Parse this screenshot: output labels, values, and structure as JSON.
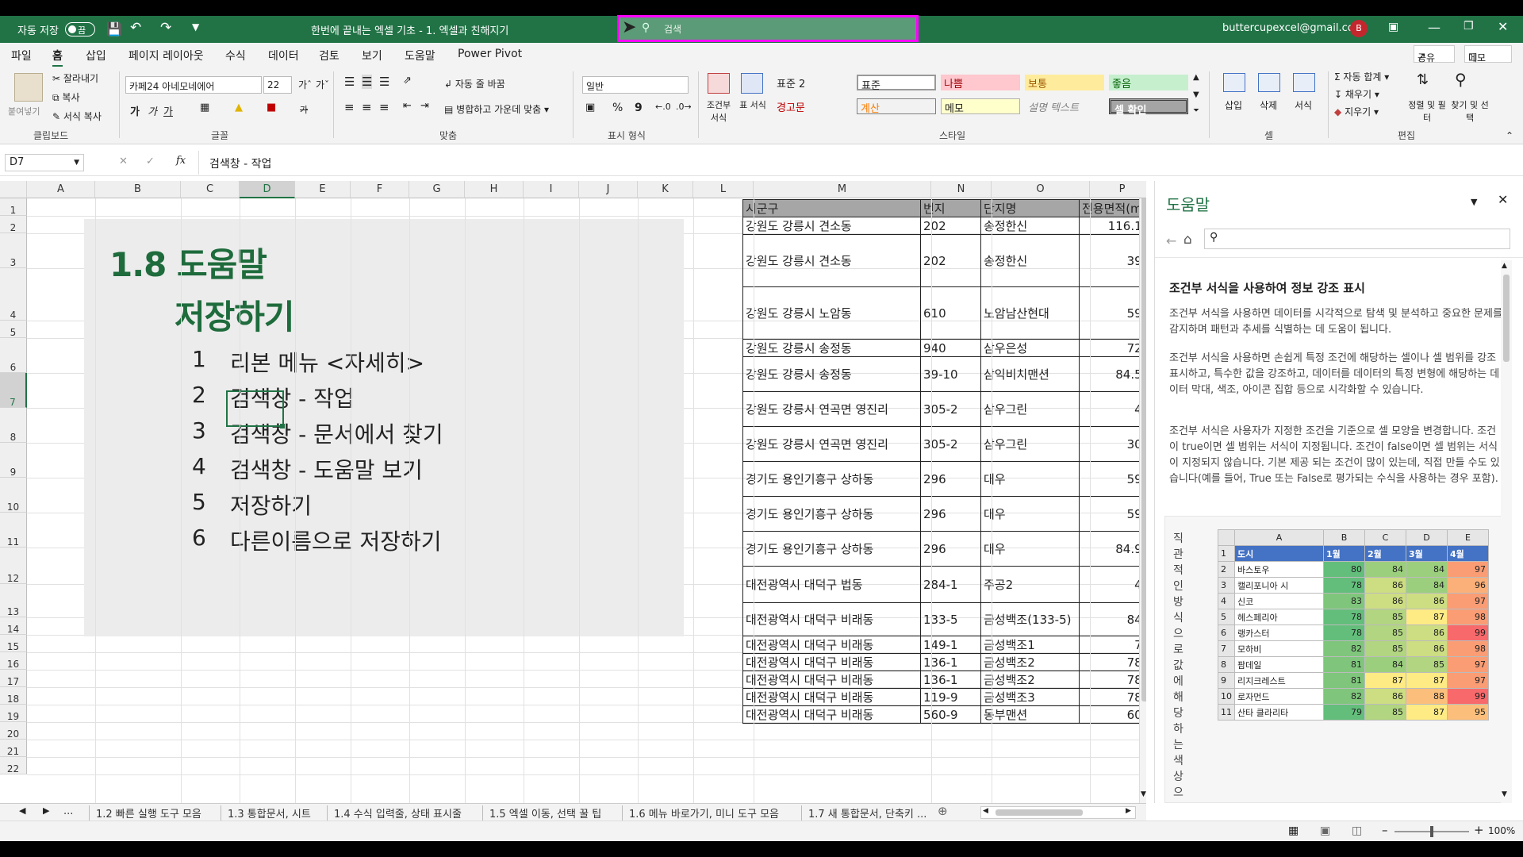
{
  "titlebar": {
    "autosave_label": "자동 저장",
    "toggle_state": "끔",
    "doc_title": "한번에 끝내는 엑셀 기초 - 1. 엑셀과 친해지기",
    "search_placeholder": "검색",
    "user_email": "buttercupexcel@gmail.com",
    "avatar_initial": "B"
  },
  "ribbon_tabs": [
    "파일",
    "홈",
    "삽입",
    "페이지 레이아웃",
    "수식",
    "데이터",
    "검토",
    "보기",
    "도움말",
    "Power Pivot"
  ],
  "share_label": "공유",
  "memo_label": "메모",
  "clipboard": {
    "paste": "붙여넣기",
    "cut": "잘라내기",
    "copy": "복사",
    "format_painter": "서식 복사",
    "group": "클립보드"
  },
  "font": {
    "name": "카페24 아네모네에어",
    "size": "22",
    "group": "글꼴",
    "bold": "가",
    "italic": "가",
    "underline": "가",
    "strike": "가"
  },
  "align": {
    "wrap": "자동 줄 바꿈",
    "merge": "병합하고 가운데 맞춤",
    "group": "맞춤"
  },
  "number": {
    "format": "일반",
    "group": "표시 형식",
    "percent": "%",
    "comma": "9"
  },
  "styles": {
    "conditional": "조건부 서식",
    "table": "표 서식",
    "group": "스타일",
    "cells": [
      "표준 2",
      "표준",
      "나쁨",
      "보통",
      "좋음",
      "경고문",
      "계산",
      "메모",
      "설명 텍스트",
      "셀 확인"
    ]
  },
  "cells_group": {
    "insert": "삽입",
    "delete": "삭제",
    "format": "서식",
    "group": "셀"
  },
  "edit_group": {
    "autosum": "자동 합계",
    "fill": "채우기",
    "clear": "지우기",
    "sort": "정렬 및 필터",
    "find": "찾기 및 선택",
    "group": "편집"
  },
  "formula_bar": {
    "name_box": "D7",
    "fx": "fx",
    "content": "검색창 - 작업"
  },
  "columns": [
    "A",
    "B",
    "C",
    "D",
    "E",
    "F",
    "G",
    "H",
    "I",
    "J",
    "K",
    "L",
    "M",
    "N",
    "O",
    "P"
  ],
  "rows": [
    "1",
    "2",
    "3",
    "4",
    "5",
    "6",
    "7",
    "8",
    "9",
    "10",
    "11",
    "12",
    "13",
    "14",
    "15",
    "16",
    "17",
    "18",
    "19",
    "20",
    "21",
    "22"
  ],
  "slide": {
    "title_line1": "1.8 도움말",
    "title_line2": "저장하기",
    "items": [
      {
        "num": "1",
        "text": "리본 메뉴 <자세히>"
      },
      {
        "num": "2",
        "text": "검색창 - 작업"
      },
      {
        "num": "3",
        "text": "검색창 - 문서에서 찾기"
      },
      {
        "num": "4",
        "text": "검색창 - 도움말 보기"
      },
      {
        "num": "5",
        "text": "저장하기"
      },
      {
        "num": "6",
        "text": "다른이름으로 저장하기"
      }
    ]
  },
  "table": {
    "headers": [
      "시군구",
      "번지",
      "단지명",
      "전용면적(m"
    ],
    "rows": [
      [
        "강원도 강릉시 견소동",
        "202",
        "송정한신",
        "116.1"
      ],
      [
        "강원도 강릉시 견소동",
        "202",
        "송정한신",
        "39"
      ],
      [
        "강원도 강릉시 노암동",
        "610",
        "노암남산현대",
        "59"
      ],
      [
        "강원도 강릉시 송정동",
        "940",
        "삼우은성",
        "72"
      ],
      [
        "강원도 강릉시 송정동",
        "39-10",
        "삼익비치맨션",
        "84.5"
      ],
      [
        "강원도 강릉시 연곡면 영진리",
        "305-2",
        "삼우그린",
        "4"
      ],
      [
        "강원도 강릉시 연곡면 영진리",
        "305-2",
        "삼우그린",
        "30"
      ],
      [
        "경기도 용인기흥구 상하동",
        "296",
        "대우",
        "59"
      ],
      [
        "경기도 용인기흥구 상하동",
        "296",
        "대우",
        "59"
      ],
      [
        "경기도 용인기흥구 상하동",
        "296",
        "대우",
        "84.9"
      ],
      [
        "대전광역시 대덕구 법동",
        "284-1",
        "주공2",
        "4"
      ],
      [
        "대전광역시 대덕구 비래동",
        "133-5",
        "금성백조(133-5)",
        "84"
      ],
      [
        "대전광역시 대덕구 비래동",
        "149-1",
        "금성백조1",
        "7"
      ],
      [
        "대전광역시 대덕구 비래동",
        "136-1",
        "금성백조2",
        "78"
      ],
      [
        "대전광역시 대덕구 비래동",
        "136-1",
        "금성백조2",
        "78"
      ],
      [
        "대전광역시 대덕구 비래동",
        "119-9",
        "금성백조3",
        "78"
      ],
      [
        "대전광역시 대덕구 비래동",
        "560-9",
        "동부맨션",
        "60"
      ]
    ]
  },
  "help": {
    "title": "도움말",
    "heading": "조건부 서식을 사용하여 정보 강조 표시",
    "p1": "조건부 서식을 사용하면 데이터를 시각적으로 탐색 및 분석하고 중요한 문제를 감지하며 패턴과 추세를 식별하는 데 도움이 됩니다.",
    "p2": "조건부 서식을 사용하면 손쉽게 특정 조건에 해당하는 셀이나 셀 범위를 강조 표시하고, 특수한 값을 강조하고, 데이터를 데이터의 특정 변형에 해당하는 데이터 막대, 색조, 아이콘 집합 등으로 시각화할 수 있습니다.",
    "p3": "조건부 서식은 사용자가 지정한 조건을 기준으로 셀 모양을 변경합니다. 조건이 true이면 셀 범위는 서식이 지정됩니다. 조건이 false이면 셀 범위는 서식이 지정되지 않습니다. 기본 제공 되는 조건이 많이 있는데, 직접 만들 수도 있습니다(예를 들어, True 또는 False로 평가되는 수식을 사용하는 경우 포함).",
    "caption": "직관적인방식으로값에해당하는색상으",
    "mini_cols": [
      "A",
      "B",
      "C",
      "D",
      "E"
    ],
    "mini_headers": [
      "도시",
      "1월",
      "2월",
      "3월",
      "4월"
    ],
    "mini_rows": [
      [
        "바스토우",
        "80",
        "84",
        "84",
        "97"
      ],
      [
        "캘리포니아 시",
        "78",
        "86",
        "84",
        "96"
      ],
      [
        "신코",
        "83",
        "86",
        "86",
        "97"
      ],
      [
        "헤스페리아",
        "78",
        "85",
        "87",
        "98"
      ],
      [
        "랭카스터",
        "78",
        "85",
        "86",
        "99"
      ],
      [
        "모하비",
        "82",
        "85",
        "86",
        "98"
      ],
      [
        "팜데일",
        "81",
        "84",
        "85",
        "97"
      ],
      [
        "리지크레스트",
        "81",
        "87",
        "87",
        "97"
      ],
      [
        "로자먼드",
        "82",
        "86",
        "88",
        "99"
      ],
      [
        "산타 클라리타",
        "79",
        "85",
        "87",
        "95"
      ]
    ]
  },
  "sheet_tabs": [
    "...",
    "1.2 빠른 실행 도구 모음",
    "1.3 통합문서, 시트",
    "1.4 수식 입력줄, 상태 표시줄",
    "1.5 엑셀 이동, 선택 꿀 팁",
    "1.6 메뉴 바로가기, 미니 도구 모음",
    "1.7 새 통합문서, 단축키 ..."
  ],
  "zoom": "100%"
}
